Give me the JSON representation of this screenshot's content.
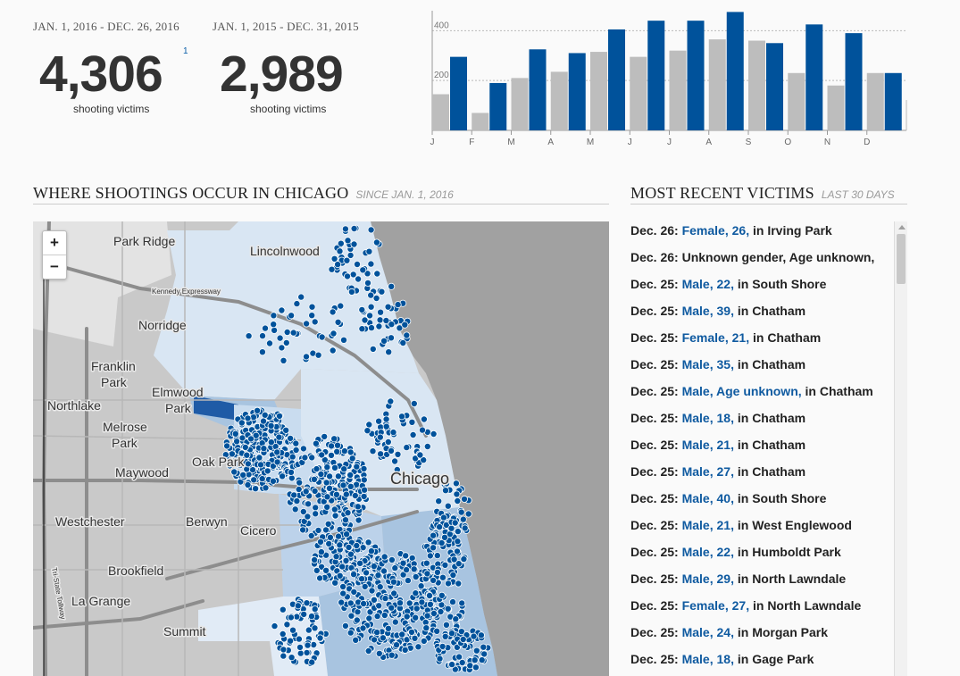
{
  "stats": {
    "current": {
      "range": "JAN. 1, 2016 - DEC. 26, 2016",
      "number": "4,306",
      "footnote": "1",
      "caption": "shooting victims"
    },
    "previous": {
      "range": "JAN. 1, 2015 - DEC. 31, 2015",
      "number": "2,989",
      "caption": "shooting victims"
    }
  },
  "colors": {
    "accent_blue": "#00529b",
    "prior_gray": "#bdbdbd",
    "link_blue": "#0f5aa0",
    "district_dark": "#1f5ba6",
    "district_mid": "#a8c4e0",
    "district_light": "#d9e6f3"
  },
  "chart_data": {
    "type": "bar",
    "categories": [
      "J",
      "F",
      "M",
      "A",
      "M",
      "J",
      "J",
      "A",
      "S",
      "O",
      "N",
      "D"
    ],
    "series": [
      {
        "values": [
          145,
          70,
          210,
          235,
          315,
          295,
          320,
          365,
          360,
          230,
          180,
          230
        ]
      },
      {
        "values": [
          295,
          190,
          325,
          310,
          405,
          440,
          440,
          475,
          350,
          425,
          390,
          230
        ]
      }
    ],
    "yticks": [
      200,
      400
    ],
    "ylim": [
      0,
      480
    ],
    "grid": true,
    "legend": "none"
  },
  "map_section": {
    "title": "WHERE SHOOTINGS OCCUR IN CHICAGO",
    "subtitle": "SINCE JAN. 1, 2016",
    "zoom_in": "+",
    "zoom_out": "−",
    "place_labels": {
      "park_ridge": "Park Ridge",
      "lincolnwood": "Lincolnwood",
      "kennedy": "Kennedy Expressway",
      "norridge": "Norridge",
      "franklin_park_1": "Franklin",
      "franklin_park_2": "Park",
      "elmwood_park_1": "Elmwood",
      "elmwood_park_2": "Park",
      "northlake": "Northlake",
      "melrose_park_1": "Melrose",
      "melrose_park_2": "Park",
      "oak_park": "Oak Park",
      "maywood": "Maywood",
      "chicago": "Chicago",
      "westchester": "Westchester",
      "berwyn": "Berwyn",
      "cicero": "Cicero",
      "brookfield": "Brookfield",
      "la_grange": "La Grange",
      "summit": "Summit",
      "tollway": "Tri-State Tollway"
    }
  },
  "victims_section": {
    "title": "MOST RECENT VICTIMS",
    "subtitle": "LAST 30 DAYS",
    "items": [
      {
        "date": "Dec. 26:",
        "link": "Female, 26,",
        "rest": " in Irving Park"
      },
      {
        "date": "Dec. 26:",
        "link": "",
        "rest": " Unknown gender, Age unknown,"
      },
      {
        "date": "Dec. 25:",
        "link": "Male, 22,",
        "rest": " in South Shore"
      },
      {
        "date": "Dec. 25:",
        "link": "Male, 39,",
        "rest": " in Chatham"
      },
      {
        "date": "Dec. 25:",
        "link": "Female, 21,",
        "rest": " in Chatham"
      },
      {
        "date": "Dec. 25:",
        "link": "Male, 35,",
        "rest": " in Chatham"
      },
      {
        "date": "Dec. 25:",
        "link": "Male, Age unknown,",
        "rest": " in Chatham"
      },
      {
        "date": "Dec. 25:",
        "link": "Male, 18,",
        "rest": " in Chatham"
      },
      {
        "date": "Dec. 25:",
        "link": "Male, 21,",
        "rest": " in Chatham"
      },
      {
        "date": "Dec. 25:",
        "link": "Male, 27,",
        "rest": " in Chatham"
      },
      {
        "date": "Dec. 25:",
        "link": "Male, 40,",
        "rest": " in South Shore"
      },
      {
        "date": "Dec. 25:",
        "link": "Male, 21,",
        "rest": " in West Englewood"
      },
      {
        "date": "Dec. 25:",
        "link": "Male, 22,",
        "rest": " in Humboldt Park"
      },
      {
        "date": "Dec. 25:",
        "link": "Male, 29,",
        "rest": " in North Lawndale"
      },
      {
        "date": "Dec. 25:",
        "link": "Female, 27,",
        "rest": " in North Lawndale"
      },
      {
        "date": "Dec. 25:",
        "link": "Male, 24,",
        "rest": " in Morgan Park"
      },
      {
        "date": "Dec. 25:",
        "link": "Male, 18,",
        "rest": " in Gage Park"
      }
    ]
  }
}
